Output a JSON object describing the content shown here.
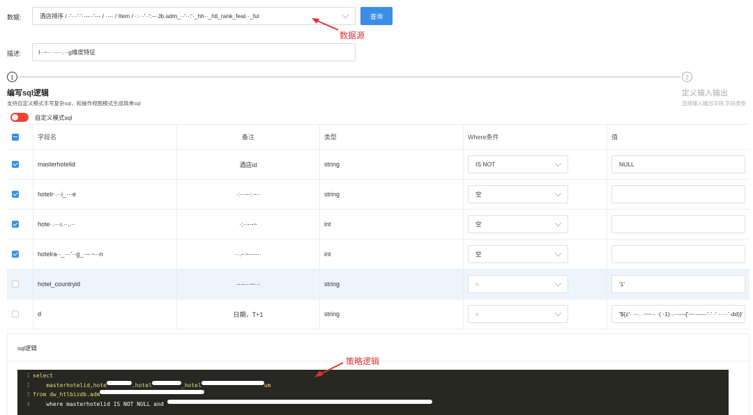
{
  "datasource": {
    "label": "数据:",
    "value": "酒店排序 / ·'···'·'··--··'--- / ··-· / Item / ·:· ·'··':--·Jb.adm_··'··:'·_hh··_htl_rank_feat··_ful",
    "query_button": "查询",
    "annotation": "数据源"
  },
  "description": {
    "label": "描述:",
    "value": "I··~·· ·····.··g维度特征"
  },
  "steps": [
    {
      "num": "1",
      "title": "编写sql逻辑",
      "sub": "支持自定义模式手写复杂sql，和操作视图模式生成简单sql"
    },
    {
      "num": "2",
      "title": "定义输入输出",
      "sub": "选择输入输出字段,字段类型"
    }
  ],
  "mode_toggle": {
    "label": "自定义模式sql"
  },
  "table": {
    "headers": [
      "字段名",
      "备注",
      "类型",
      "Where条件",
      "值"
    ],
    "rows": [
      {
        "checked": true,
        "field": "masterhotelid",
        "note": "酒店id",
        "type": "string",
        "where": "IS NOT",
        "value": "NULL",
        "highlight": false
      },
      {
        "checked": true,
        "field": "hotelr·.··i_···e",
        "note": "·:···-·:·-··",
        "type": "string",
        "where": "空",
        "value": "",
        "highlight": false
      },
      {
        "checked": true,
        "field": "hote·.···ı.··..··",
        "note": "·:··-·-~",
        "type": "int",
        "where": "空",
        "value": "",
        "highlight": false
      },
      {
        "checked": true,
        "field": "hotelra··_···'··g_·--·~··n",
        "note": "··.-·~·-·-··",
        "type": "int",
        "where": "空",
        "value": "",
        "highlight": false
      },
      {
        "checked": false,
        "field": "hotel_countryid",
        "note": "·-·-···~···",
        "type": "string",
        "where": "=",
        "value": "'1'",
        "highlight": true
      },
      {
        "checked": false,
        "field": "d",
        "note": "日期，T+1",
        "type": "string",
        "where": "=",
        "value": "'${z'· ···. ·~~·- ·( ·1)·.-·----{'-~·-----·'·' ·' ·····'·dd)}'",
        "highlight": false
      }
    ]
  },
  "sql": {
    "title": "sql逻辑",
    "annotation": "策略逻辑",
    "lines": [
      {
        "n": "1",
        "text": "select"
      },
      {
        "n": "2",
        "text": "    masterhotelid,hote"
      },
      {
        "n": "3",
        "text": "from dw_htlbizdb.adm"
      },
      {
        "n": "4",
        "text": "    where masterhotelid IS NOT NULL and "
      }
    ],
    "line2_tail_a": ".hotel",
    "line2_tail_b": "_hotel",
    "line2_tail_c": "um"
  },
  "colors": {
    "accent": "#3a8ee6",
    "annotation": "#e0312f",
    "toggle_on": "#f04134",
    "code_bg": "#272822"
  },
  "icons": [
    "chevron-down-icon",
    "checkbox-icon",
    "arrow-annotation-icon"
  ]
}
